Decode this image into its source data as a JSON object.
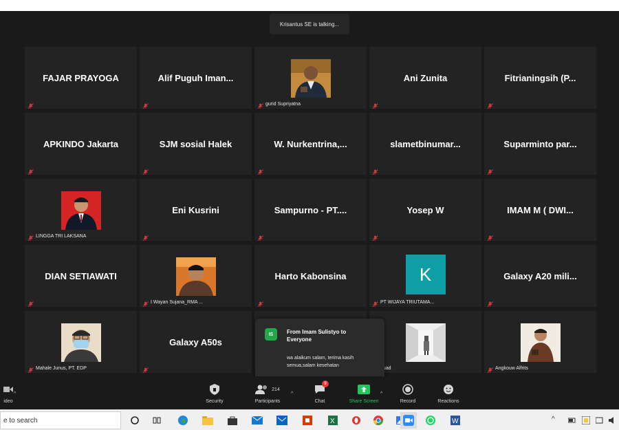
{
  "talking_banner": "Krisantus SE is talking...",
  "tiles": [
    {
      "name": "FAJAR PRAYOGA",
      "type": "name"
    },
    {
      "name": "Alif Puguh Iman...",
      "type": "name"
    },
    {
      "name": "gurid Supriyatna",
      "type": "photo",
      "photo": "man-suit-dark"
    },
    {
      "name": "Ani Zunita",
      "type": "name"
    },
    {
      "name": "Fitrianingsih (P...",
      "type": "name"
    },
    {
      "name": "APKINDO Jakarta",
      "type": "name"
    },
    {
      "name": "SJM sosial Halek",
      "type": "name"
    },
    {
      "name": "W. Nurkentrina,...",
      "type": "name"
    },
    {
      "name": "slametbinumar...",
      "type": "name"
    },
    {
      "name": "Suparminto par...",
      "type": "name"
    },
    {
      "name": "LINGGA TRI LAKSANA",
      "type": "photo",
      "photo": "man-red-bg"
    },
    {
      "name": "Eni Kusrini",
      "type": "name"
    },
    {
      "name": "Sampurno - PT....",
      "type": "name"
    },
    {
      "name": "Yosep W",
      "type": "name"
    },
    {
      "name": "IMAM M ( DWI...",
      "type": "name"
    },
    {
      "name": "DIAN SETIAWATI",
      "type": "name"
    },
    {
      "name": "I Wayan Sujana_RMA ...",
      "type": "photo",
      "photo": "man-orange-bg"
    },
    {
      "name": "Harto Kabonsina",
      "type": "name"
    },
    {
      "name": "PT WIJAYA TRIUTAMA...",
      "type": "avatar",
      "initial": "K"
    },
    {
      "name": "Galaxy A20 mili...",
      "type": "name"
    },
    {
      "name": "Mahale Junus, PT. EDP",
      "type": "photo",
      "photo": "man-mask"
    },
    {
      "name": "Galaxy A50s",
      "type": "name"
    },
    {
      "name": "",
      "type": "hidden"
    },
    {
      "name": "quad",
      "type": "photo",
      "photo": "hallway"
    },
    {
      "name": "Angkouw Alfrits",
      "type": "photo",
      "photo": "man-brown"
    }
  ],
  "chat_popup": {
    "initials": "IS",
    "from": "From Imam Sulistyo to Everyone",
    "message": "wa alaikum salam, terima kasih semua,salam kesehatan"
  },
  "toolbar": {
    "video": "ideo",
    "security": "Security",
    "participants": "Participants",
    "participants_count": "214",
    "chat": "Chat",
    "chat_badge": "9",
    "share": "Share Screen",
    "record": "Record",
    "reactions": "Reactions"
  },
  "taskbar": {
    "search_placeholder": "e to search",
    "apps": [
      "search-circle-icon",
      "task-view-icon",
      "edge-icon",
      "file-explorer-icon",
      "store-icon",
      "mail-icon",
      "mcafee-icon",
      "office-icon",
      "excel-icon",
      "opera-icon",
      "chrome-icon",
      "photos-icon",
      "zoom-icon",
      "whatsapp-icon",
      "word-icon"
    ]
  },
  "colors": {
    "meeting_bg": "#1a1a1a",
    "tile_bg": "#232323",
    "muted_red": "#e03a3a",
    "share_green": "#22c55e",
    "avatar_teal": "#0f9ea6"
  }
}
